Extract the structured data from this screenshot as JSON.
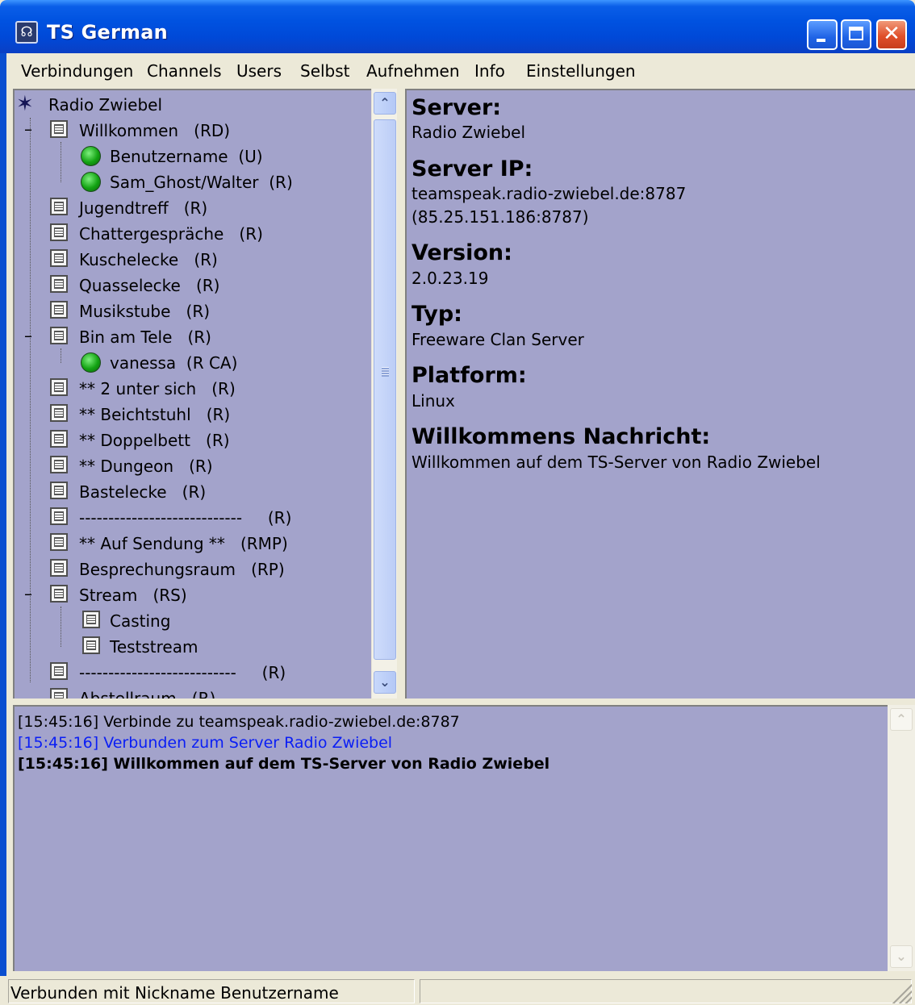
{
  "window": {
    "title": "TS German"
  },
  "menu": [
    "Verbindungen",
    "Channels",
    "Users",
    "Selbst",
    "Aufnehmen",
    "Info",
    "Einstellungen"
  ],
  "tree": {
    "server": "Radio Zwiebel",
    "rows": [
      {
        "label": "Willkommen",
        "flags": "(RD)"
      },
      {
        "label": "Benutzername",
        "flags": "(U)"
      },
      {
        "label": "Sam_Ghost/Walter",
        "flags": "(R)"
      },
      {
        "label": "Jugendtreff",
        "flags": "(R)"
      },
      {
        "label": "Chattergespräche",
        "flags": "(R)"
      },
      {
        "label": "Kuschelecke",
        "flags": "(R)"
      },
      {
        "label": "Quasselecke",
        "flags": "(R)"
      },
      {
        "label": "Musikstube",
        "flags": "(R)"
      },
      {
        "label": "Bin am Tele",
        "flags": "(R)"
      },
      {
        "label": "vanessa",
        "flags": "(R CA)"
      },
      {
        "label": "** 2 unter sich",
        "flags": "(R)"
      },
      {
        "label": "** Beichtstuhl",
        "flags": "(R)"
      },
      {
        "label": "** Doppelbett",
        "flags": "(R)"
      },
      {
        "label": "** Dungeon",
        "flags": "(R)"
      },
      {
        "label": "Bastelecke",
        "flags": "(R)"
      },
      {
        "label": "----------------------------",
        "flags": "(R)"
      },
      {
        "label": "** Auf Sendung **",
        "flags": "(RMP)"
      },
      {
        "label": "Besprechungsraum",
        "flags": "(RP)"
      },
      {
        "label": "Stream",
        "flags": "(RS)"
      },
      {
        "label": "Casting",
        "flags": ""
      },
      {
        "label": "Teststream",
        "flags": ""
      },
      {
        "label": "---------------------------",
        "flags": "(R)"
      },
      {
        "label": "Abstellraum",
        "flags": "(R)"
      }
    ]
  },
  "info": {
    "server_label": "Server:",
    "server_value": "Radio Zwiebel",
    "ip_label": "Server IP:",
    "ip_value_1": "teamspeak.radio-zwiebel.de:8787",
    "ip_value_2": "(85.25.151.186:8787)",
    "version_label": "Version:",
    "version_value": "2.0.23.19",
    "type_label": "Typ:",
    "type_value": "Freeware Clan Server",
    "platform_label": "Platform:",
    "platform_value": "Linux",
    "welcome_label": "Willkommens Nachricht:",
    "welcome_value": "Willkommen auf dem TS-Server von Radio Zwiebel"
  },
  "log": [
    {
      "text": "[15:45:16] Verbinde zu teamspeak.radio-zwiebel.de:8787",
      "color": "#000000",
      "bold": false
    },
    {
      "text": "[15:45:16] Verbunden zum Server Radio Zwiebel",
      "color": "#0a1ef5",
      "bold": false
    },
    {
      "text": "[15:45:16] Willkommen auf dem TS-Server von Radio Zwiebel",
      "color": "#000000",
      "bold": true
    }
  ],
  "status": {
    "text": "Verbunden mit Nickname Benutzername"
  },
  "colors": {
    "panel_bg": "#a3a3cb",
    "titlebar": "#0052e0",
    "user_online": "#13a313"
  },
  "icons": {
    "server": "server-star-icon",
    "channel": "channel-icon",
    "user": "user-green-icon"
  }
}
